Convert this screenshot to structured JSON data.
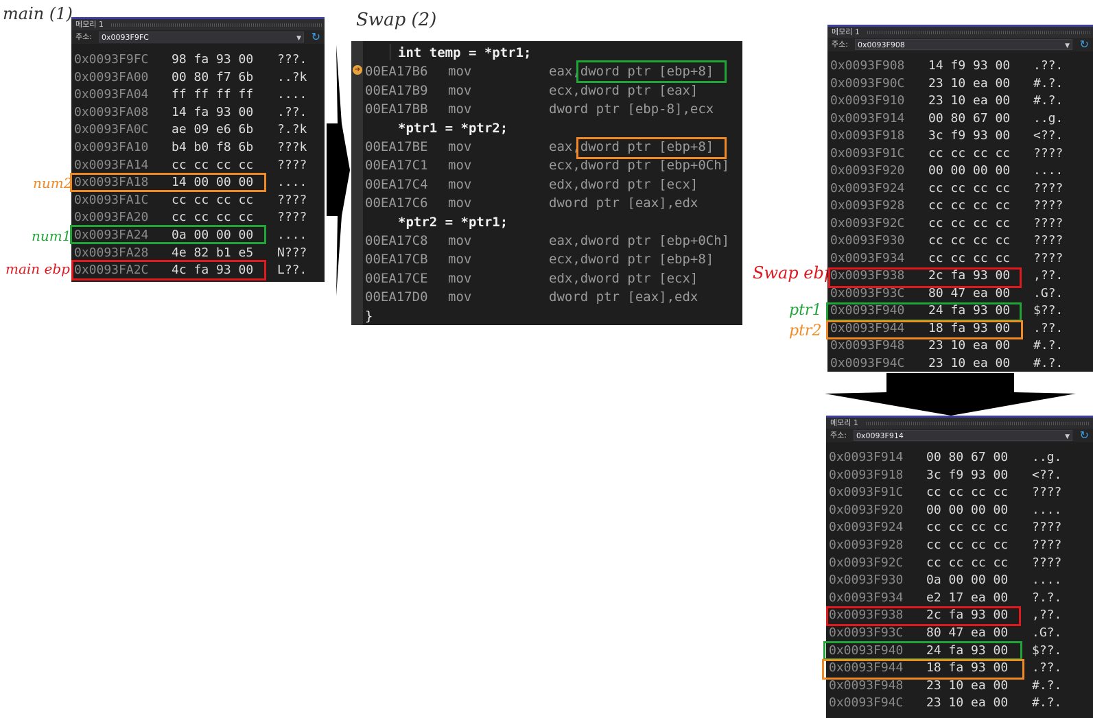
{
  "annotations": {
    "main_title": "main (1)",
    "swap_title": "Swap (2)",
    "num2": "num2",
    "num1": "num1",
    "main_ebp": "main ebp",
    "swap_ebp": "Swap ebp",
    "ptr1": "ptr1",
    "ptr2": "ptr2",
    "colors": {
      "green": "#1fa637",
      "orange": "#f08a24",
      "red": "#e0191f"
    }
  },
  "memory_main": {
    "title": "메모리 1",
    "addr_label": "주소:",
    "address": "0x0093F9FC",
    "rows": [
      {
        "addr": "0x0093F9FC",
        "bytes": "98 fa 93 00",
        "ascii": "???."
      },
      {
        "addr": "0x0093FA00",
        "bytes": "00 80 f7 6b",
        "ascii": "..?k"
      },
      {
        "addr": "0x0093FA04",
        "bytes": "ff ff ff ff",
        "ascii": "...."
      },
      {
        "addr": "0x0093FA08",
        "bytes": "14 fa 93 00",
        "ascii": ".??."
      },
      {
        "addr": "0x0093FA0C",
        "bytes": "ae 09 e6 6b",
        "ascii": "?.?k"
      },
      {
        "addr": "0x0093FA10",
        "bytes": "b4 b0 f8 6b",
        "ascii": "???k"
      },
      {
        "addr": "0x0093FA14",
        "bytes": "cc cc cc cc",
        "ascii": "????"
      },
      {
        "addr": "0x0093FA18",
        "bytes": "14 00 00 00",
        "ascii": "...."
      },
      {
        "addr": "0x0093FA1C",
        "bytes": "cc cc cc cc",
        "ascii": "????"
      },
      {
        "addr": "0x0093FA20",
        "bytes": "cc cc cc cc",
        "ascii": "????"
      },
      {
        "addr": "0x0093FA24",
        "bytes": "0a 00 00 00",
        "ascii": "...."
      },
      {
        "addr": "0x0093FA28",
        "bytes": "4e 82 b1 e5",
        "ascii": "N???"
      },
      {
        "addr": "0x0093FA2C",
        "bytes": "4c fa 93 00",
        "ascii": "L??."
      }
    ]
  },
  "disasm": {
    "lines": [
      {
        "kind": "src",
        "text": "int temp = *ptr1;"
      },
      {
        "kind": "asm",
        "addr": "00EA17B6",
        "op": "mov",
        "arg": "eax,dword ptr [ebp+8]"
      },
      {
        "kind": "asm",
        "addr": "00EA17B9",
        "op": "mov",
        "arg": "ecx,dword ptr [eax]"
      },
      {
        "kind": "asm",
        "addr": "00EA17BB",
        "op": "mov",
        "arg": "dword ptr [ebp-8],ecx"
      },
      {
        "kind": "src",
        "text": "*ptr1 = *ptr2;"
      },
      {
        "kind": "asm",
        "addr": "00EA17BE",
        "op": "mov",
        "arg": "eax,dword ptr [ebp+8]"
      },
      {
        "kind": "asm",
        "addr": "00EA17C1",
        "op": "mov",
        "arg": "ecx,dword ptr [ebp+0Ch]"
      },
      {
        "kind": "asm",
        "addr": "00EA17C4",
        "op": "mov",
        "arg": "edx,dword ptr [ecx]"
      },
      {
        "kind": "asm",
        "addr": "00EA17C6",
        "op": "mov",
        "arg": "dword ptr [eax],edx"
      },
      {
        "kind": "src",
        "text": "*ptr2 = *ptr1;"
      },
      {
        "kind": "asm",
        "addr": "00EA17C8",
        "op": "mov",
        "arg": "eax,dword ptr [ebp+0Ch]"
      },
      {
        "kind": "asm",
        "addr": "00EA17CB",
        "op": "mov",
        "arg": "ecx,dword ptr [ebp+8]"
      },
      {
        "kind": "asm",
        "addr": "00EA17CE",
        "op": "mov",
        "arg": "edx,dword ptr [ecx]"
      },
      {
        "kind": "asm",
        "addr": "00EA17D0",
        "op": "mov",
        "arg": "dword ptr [eax],edx"
      },
      {
        "kind": "brace",
        "text": "}"
      }
    ]
  },
  "memory_swap1": {
    "title": "메모리 1",
    "addr_label": "주소:",
    "address": "0x0093F908",
    "rows": [
      {
        "addr": "0x0093F908",
        "bytes": "14 f9 93 00",
        "ascii": ".??."
      },
      {
        "addr": "0x0093F90C",
        "bytes": "23 10 ea 00",
        "ascii": "#.?."
      },
      {
        "addr": "0x0093F910",
        "bytes": "23 10 ea 00",
        "ascii": "#.?."
      },
      {
        "addr": "0x0093F914",
        "bytes": "00 80 67 00",
        "ascii": "..g."
      },
      {
        "addr": "0x0093F918",
        "bytes": "3c f9 93 00",
        "ascii": "<??."
      },
      {
        "addr": "0x0093F91C",
        "bytes": "cc cc cc cc",
        "ascii": "????"
      },
      {
        "addr": "0x0093F920",
        "bytes": "00 00 00 00",
        "ascii": "...."
      },
      {
        "addr": "0x0093F924",
        "bytes": "cc cc cc cc",
        "ascii": "????"
      },
      {
        "addr": "0x0093F928",
        "bytes": "cc cc cc cc",
        "ascii": "????"
      },
      {
        "addr": "0x0093F92C",
        "bytes": "cc cc cc cc",
        "ascii": "????"
      },
      {
        "addr": "0x0093F930",
        "bytes": "cc cc cc cc",
        "ascii": "????"
      },
      {
        "addr": "0x0093F934",
        "bytes": "cc cc cc cc",
        "ascii": "????"
      },
      {
        "addr": "0x0093F938",
        "bytes": "2c fa 93 00",
        "ascii": ",??."
      },
      {
        "addr": "0x0093F93C",
        "bytes": "80 47 ea 00",
        "ascii": ".G?."
      },
      {
        "addr": "0x0093F940",
        "bytes": "24 fa 93 00",
        "ascii": "$??."
      },
      {
        "addr": "0x0093F944",
        "bytes": "18 fa 93 00",
        "ascii": ".??."
      },
      {
        "addr": "0x0093F948",
        "bytes": "23 10 ea 00",
        "ascii": "#.?."
      },
      {
        "addr": "0x0093F94C",
        "bytes": "23 10 ea 00",
        "ascii": "#.?."
      }
    ]
  },
  "memory_swap2": {
    "title": "메모리 1",
    "addr_label": "주소:",
    "address": "0x0093F914",
    "rows": [
      {
        "addr": "0x0093F914",
        "bytes": "00 80 67 00",
        "ascii": "..g."
      },
      {
        "addr": "0x0093F918",
        "bytes": "3c f9 93 00",
        "ascii": "<??."
      },
      {
        "addr": "0x0093F91C",
        "bytes": "cc cc cc cc",
        "ascii": "????"
      },
      {
        "addr": "0x0093F920",
        "bytes": "00 00 00 00",
        "ascii": "...."
      },
      {
        "addr": "0x0093F924",
        "bytes": "cc cc cc cc",
        "ascii": "????"
      },
      {
        "addr": "0x0093F928",
        "bytes": "cc cc cc cc",
        "ascii": "????"
      },
      {
        "addr": "0x0093F92C",
        "bytes": "cc cc cc cc",
        "ascii": "????"
      },
      {
        "addr": "0x0093F930",
        "bytes": "0a 00 00 00",
        "ascii": "...."
      },
      {
        "addr": "0x0093F934",
        "bytes": "e2 17 ea 00",
        "ascii": "?.?."
      },
      {
        "addr": "0x0093F938",
        "bytes": "2c fa 93 00",
        "ascii": ",??."
      },
      {
        "addr": "0x0093F93C",
        "bytes": "80 47 ea 00",
        "ascii": ".G?."
      },
      {
        "addr": "0x0093F940",
        "bytes": "24 fa 93 00",
        "ascii": "$??."
      },
      {
        "addr": "0x0093F944",
        "bytes": "18 fa 93 00",
        "ascii": ".??."
      },
      {
        "addr": "0x0093F948",
        "bytes": "23 10 ea 00",
        "ascii": "#.?."
      },
      {
        "addr": "0x0093F94C",
        "bytes": "23 10 ea 00",
        "ascii": "#.?."
      }
    ]
  }
}
